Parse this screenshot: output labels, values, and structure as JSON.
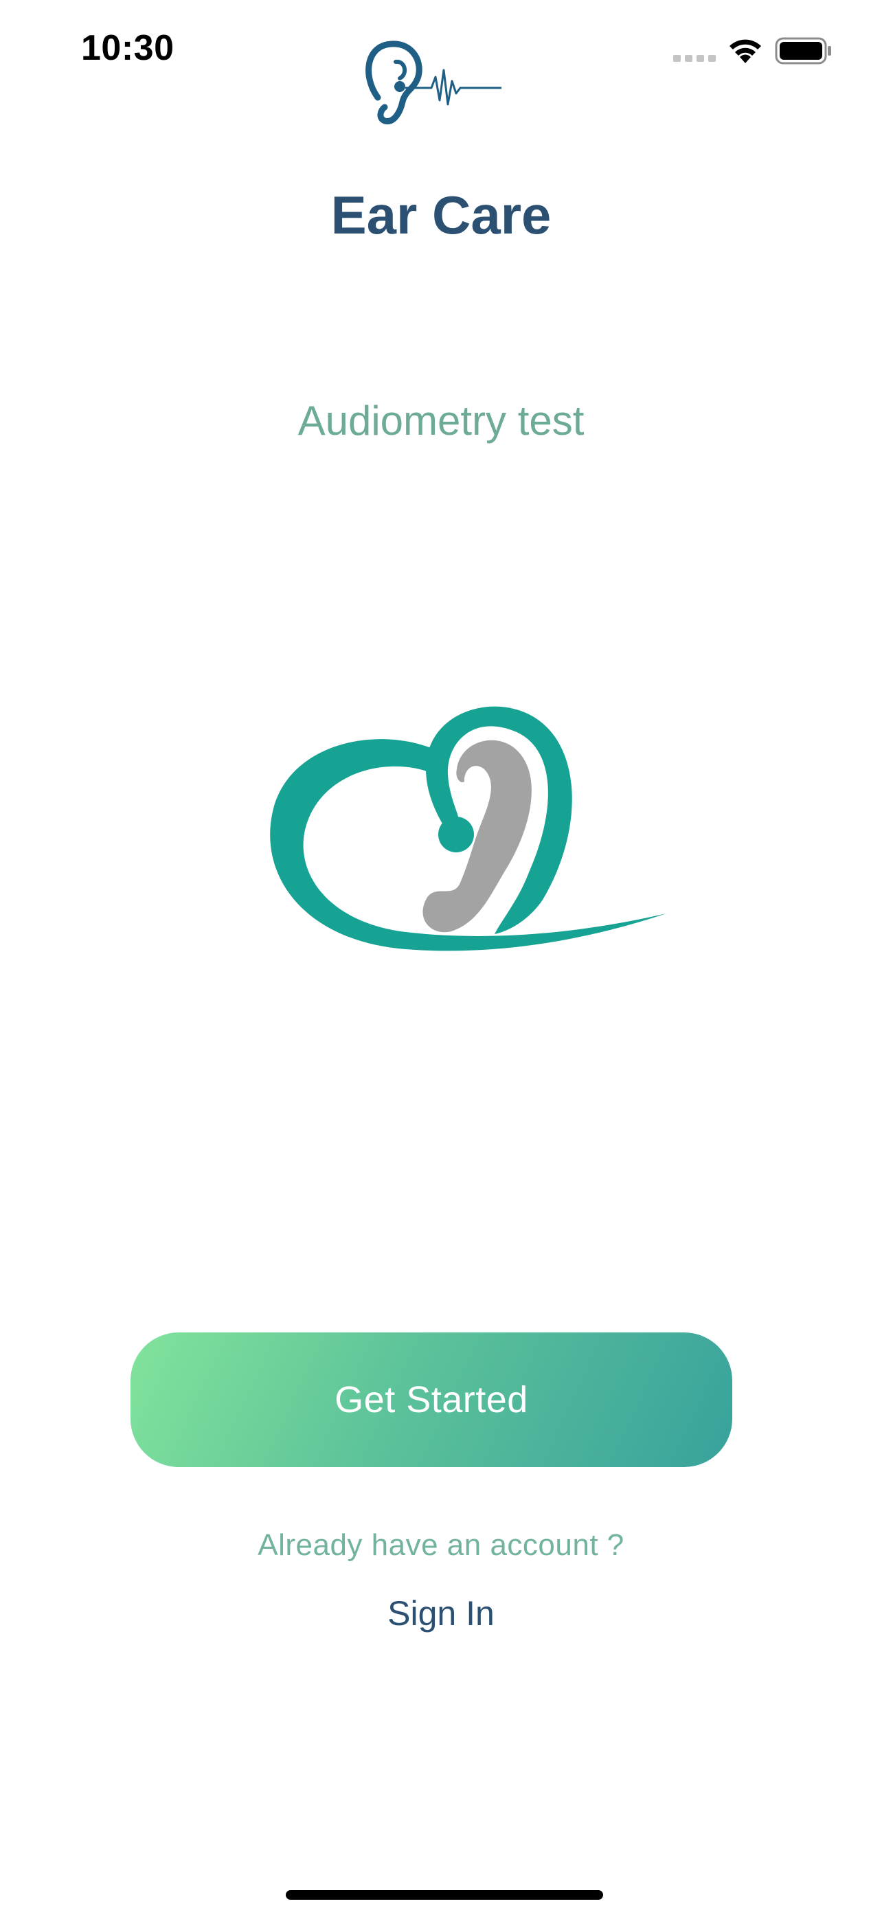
{
  "status_bar": {
    "time": "10:30"
  },
  "header": {
    "logo_icon": "ear-heartbeat-logo"
  },
  "app": {
    "title": "Ear Care",
    "subtitle": "Audiometry test",
    "hero_icon": "ear-heart-logo"
  },
  "actions": {
    "get_started_label": "Get Started",
    "account_prompt": "Already have an account ?",
    "sign_in_label": "Sign In"
  },
  "colors": {
    "title": "#2b5072",
    "accent_green": "#6dab98",
    "button_gradient_start": "#82e39b",
    "button_gradient_end": "#38a29c",
    "logo_teal": "#17a394",
    "logo_gray": "#a3a3a3"
  }
}
